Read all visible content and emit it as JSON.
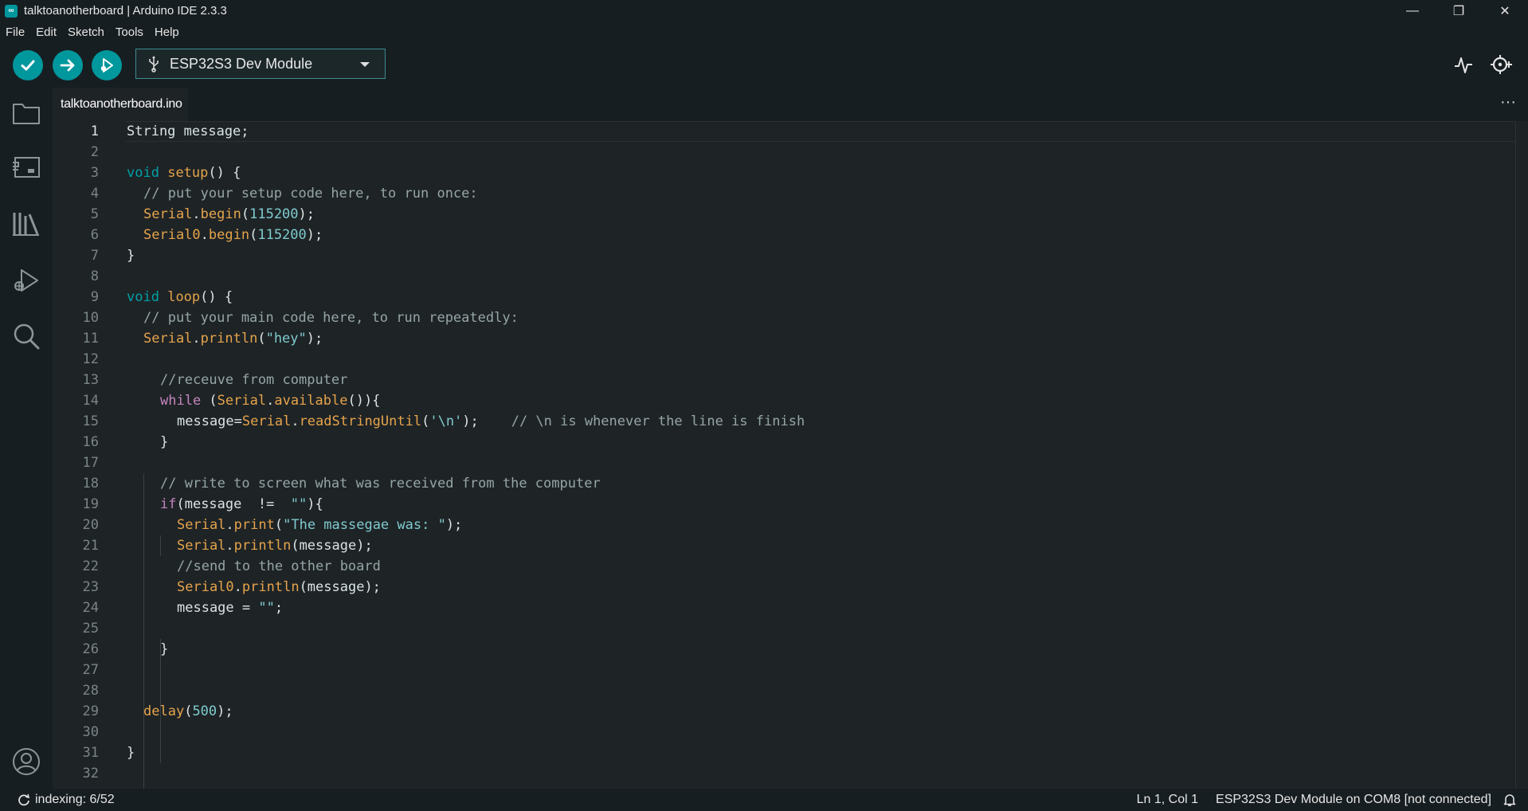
{
  "window": {
    "title": "talktoanotherboard | Arduino IDE 2.3.3",
    "app_icon_text": "∞",
    "minimize": "—",
    "maximize": "❐",
    "close": "✕"
  },
  "menu": [
    "File",
    "Edit",
    "Sketch",
    "Tools",
    "Help"
  ],
  "toolbar": {
    "verify_icon": "check-icon",
    "upload_icon": "arrow-right-icon",
    "debug_icon": "debug-icon",
    "board": "ESP32S3 Dev Module",
    "serial_plotter_icon": "serial-plotter-icon",
    "serial_monitor_icon": "serial-monitor-icon",
    "accent": "#00979d"
  },
  "activity_bar": [
    "sketchbook-icon",
    "boards-manager-icon",
    "library-manager-icon",
    "debug-icon",
    "search-icon",
    "account-icon"
  ],
  "tab": {
    "label": "talktoanotherboard.ino",
    "more": "···"
  },
  "editor": {
    "lines": [
      "1",
      "2",
      "3",
      "4",
      "5",
      "6",
      "7",
      "8",
      "9",
      "10",
      "11",
      "12",
      "13",
      "14",
      "15",
      "16",
      "17",
      "18",
      "19",
      "20",
      "21",
      "22",
      "23",
      "24",
      "25",
      "26",
      "27",
      "28",
      "29",
      "30",
      "31",
      "32"
    ],
    "code": {
      "l1": "String message;",
      "l3a": "void",
      "l3b": "setup",
      "l3c": "() {",
      "l4": "// put your setup code here, to run once:",
      "l5a": "Serial",
      "l5b": ".",
      "l5c": "begin",
      "l5d": "(",
      "l5e": "115200",
      "l5f": ");",
      "l6a": "Serial0",
      "l6b": ".",
      "l6c": "begin",
      "l6d": "(",
      "l6e": "115200",
      "l6f": ");",
      "l7": "}",
      "l9a": "void",
      "l9b": "loop",
      "l9c": "() {",
      "l10": "// put your main code here, to run repeatedly:",
      "l11a": "Serial",
      "l11b": ".",
      "l11c": "println",
      "l11d": "(",
      "l11e": "\"hey\"",
      "l11f": ");",
      "l13": "//receuve from computer",
      "l14a": "while",
      "l14b": " (",
      "l14c": "Serial",
      "l14d": ".",
      "l14e": "available",
      "l14f": "()){",
      "l15a": "message=",
      "l15b": "Serial",
      "l15c": ".",
      "l15d": "readStringUntil",
      "l15e": "(",
      "l15f": "'\\n'",
      "l15g": ");    ",
      "l15h": "// \\n is whenever the line is finish",
      "l16": "}",
      "l18": "// write to screen what was received from the computer",
      "l19a": "if",
      "l19b": "(message  !=  ",
      "l19c": "\"\"",
      "l19d": "){",
      "l20a": "Serial",
      "l20b": ".",
      "l20c": "print",
      "l20d": "(",
      "l20e": "\"The massegae was: \"",
      "l20f": ");",
      "l21a": "Serial",
      "l21b": ".",
      "l21c": "println",
      "l21d": "(message);",
      "l22": "//send to the other board",
      "l23a": "Serial0",
      "l23b": ".",
      "l23c": "println",
      "l23d": "(message);",
      "l24a": "message = ",
      "l24b": "\"\"",
      "l24c": ";",
      "l26": "}",
      "l29a": "delay",
      "l29b": "(",
      "l29c": "500",
      "l29d": ");",
      "l31": "}"
    }
  },
  "status": {
    "indexing": "indexing: 6/52",
    "position": "Ln 1, Col 1",
    "board_port": "ESP32S3 Dev Module on COM8 [not connected]",
    "notifications_icon": "bell-icon"
  }
}
